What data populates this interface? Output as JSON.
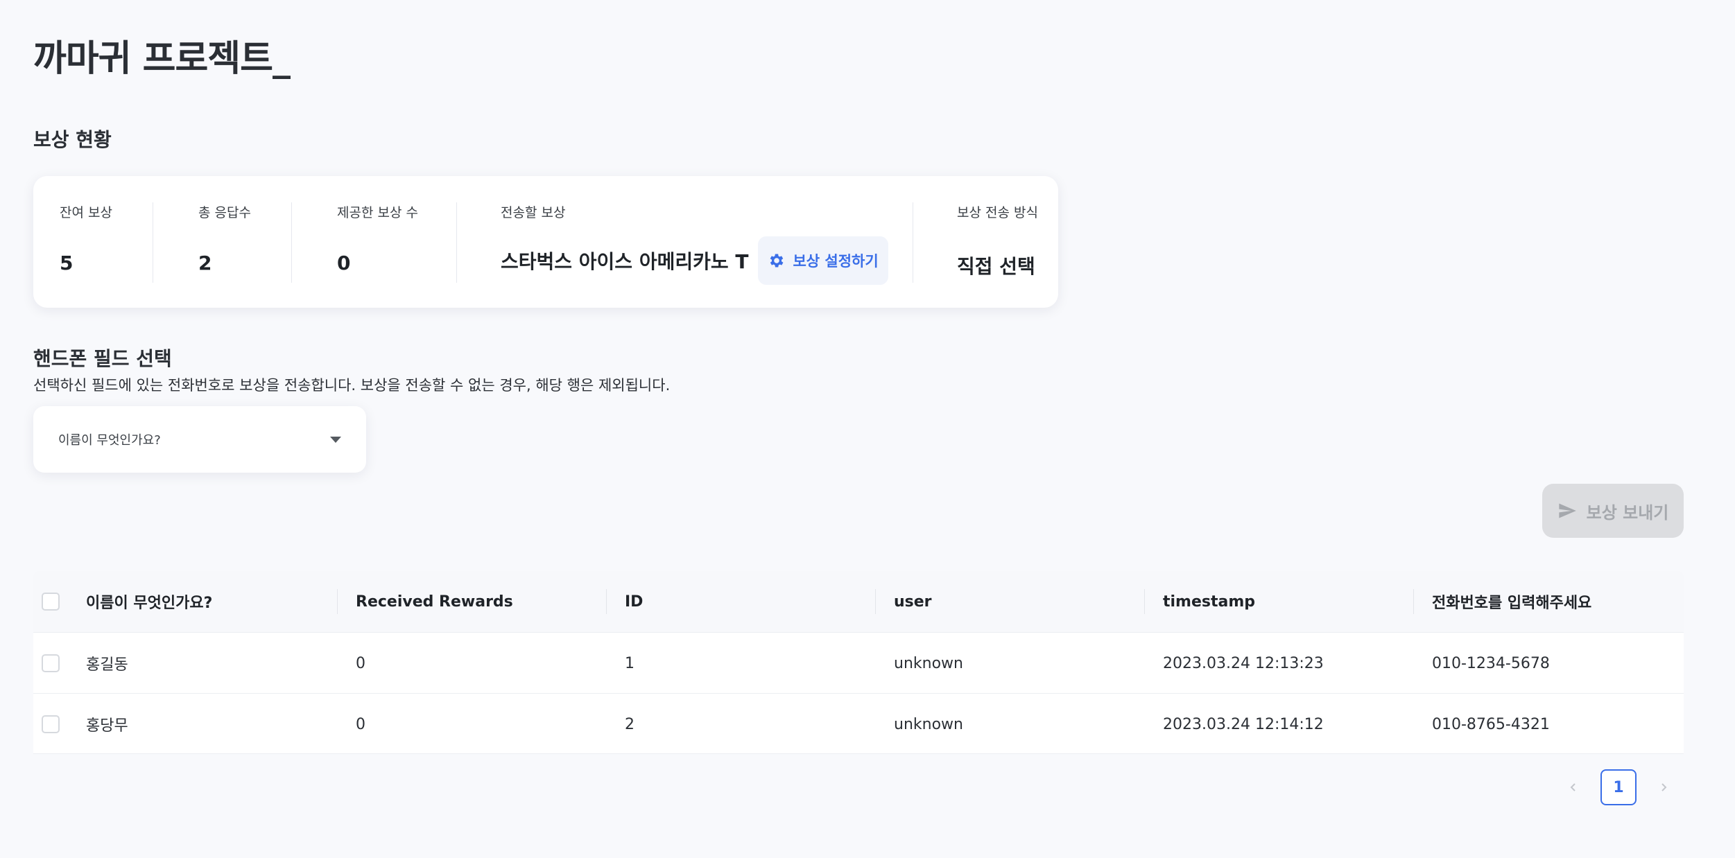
{
  "header": {
    "project_title": "까마귀 프로젝트_"
  },
  "reward_status": {
    "section_title": "보상 현황",
    "remaining_label": "잔여 보상",
    "remaining_value": "5",
    "total_responses_label": "총 응답수",
    "total_responses_value": "2",
    "provided_label": "제공한 보상 수",
    "provided_value": "0",
    "reward_to_send_label": "전송할 보상",
    "reward_to_send_value": "스타벅스 아이스 아메리카노 T",
    "settings_button_label": "보상 설정하기",
    "send_method_label": "보상 전송 방식",
    "send_method_value": "직접 선택"
  },
  "phone_field": {
    "title": "핸드폰 필드 선택",
    "description": "선택하신 필드에 있는 전화번호로 보상을 전송합니다. 보상을 전송할 수 없는 경우, 해당 행은 제외됩니다.",
    "selected": "이름이 무엇인가요?"
  },
  "send_button_label": "보상 보내기",
  "table": {
    "columns": [
      "이름이 무엇인가요?",
      "Received Rewards",
      "ID",
      "user",
      "timestamp",
      "전화번호를 입력해주세요"
    ],
    "rows": [
      [
        "홍길동",
        "0",
        "1",
        "unknown",
        "2023.03.24 12:13:23",
        "010-1234-5678"
      ],
      [
        "홍당무",
        "0",
        "2",
        "unknown",
        "2023.03.24 12:14:12",
        "010-8765-4321"
      ]
    ]
  },
  "pagination": {
    "current_page": "1",
    "prev_icon": "chevron-left-icon",
    "next_icon": "chevron-right-icon"
  },
  "colors": {
    "accent": "#3a6ee8",
    "disabled": "#dcdde0",
    "background": "#f8f9fc"
  }
}
